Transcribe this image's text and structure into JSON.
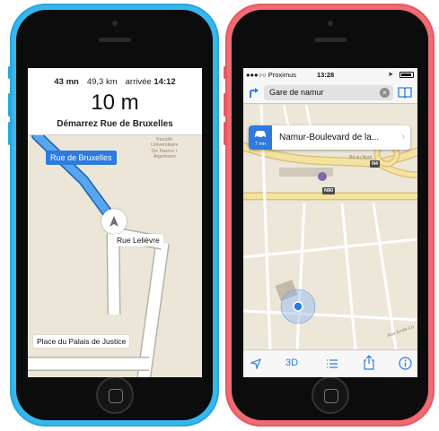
{
  "left_phone": {
    "stats": {
      "duration": "43 mn",
      "distance": "49,3 km",
      "arrival_label": "arrivée",
      "arrival_time": "14:12"
    },
    "next_distance": "10 m",
    "instruction": "Démarrez Rue de Bruxelles",
    "map": {
      "current_street": "Rue de Bruxelles",
      "street_lelievre": "Rue Lelièvre",
      "street_palais": "Place du Palais de Justice",
      "poi_lines": [
        "Faculté",
        "Universitaire",
        "De Namur /",
        "Algemeen"
      ]
    }
  },
  "right_phone": {
    "status": {
      "carrier": "●●●○○ Proximus",
      "time": "13:28"
    },
    "search_value": "Gare de namur",
    "callout": {
      "minutes": "7 mn",
      "title": "Namur-Boulevard de la..."
    },
    "road_badges": {
      "n4": "N4",
      "n90": "N90"
    },
    "streets": {
      "bd_nord": "Bd du Nord",
      "rue_emile": "Rue Emile Cu"
    },
    "toolbar": {
      "threed": "3D"
    }
  },
  "colors": {
    "blue_phone": "#35b7ee",
    "pink_phone": "#f26a72",
    "accent": "#2d7be0",
    "pin": "#e0322e"
  }
}
